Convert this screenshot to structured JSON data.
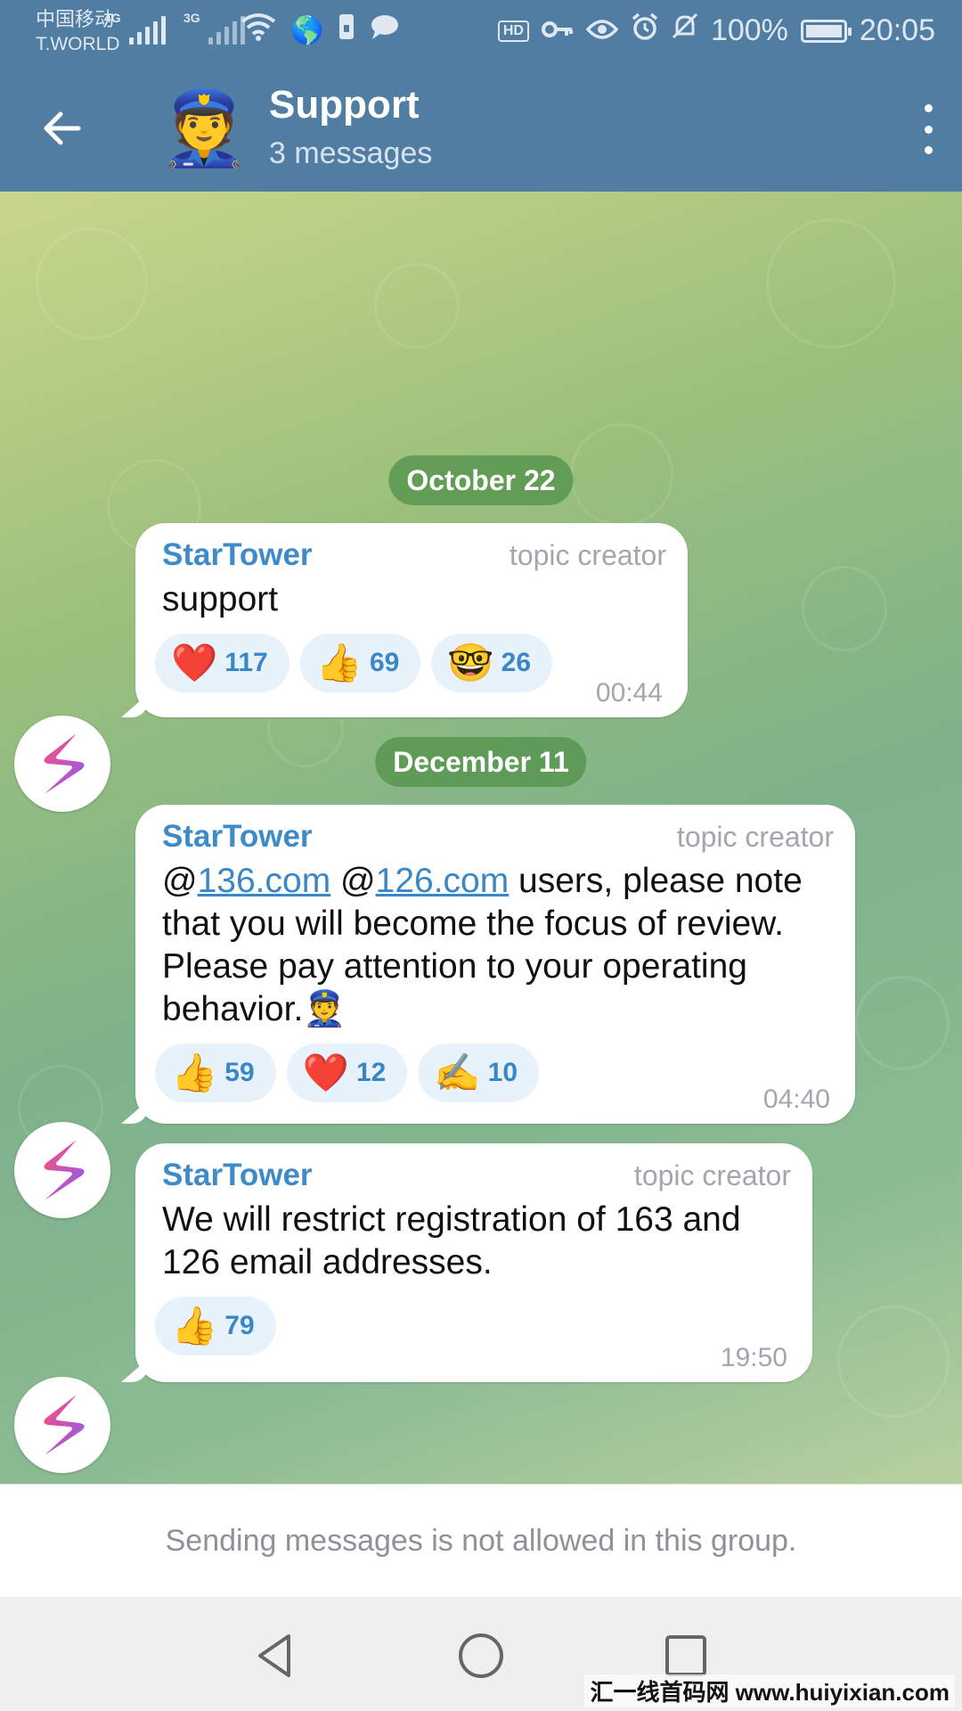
{
  "status_bar": {
    "carrier": "中国移动",
    "carrier_sub": "T.WORLD",
    "net1": "4G",
    "net2": "3G",
    "hd": "HD",
    "battery": "100%",
    "time": "20:05"
  },
  "header": {
    "title": "Support",
    "subtitle": "3 messages",
    "avatar_emoji": "👮"
  },
  "dates": [
    "October 22",
    "December 11"
  ],
  "messages": [
    {
      "sender": "StarTower",
      "role": "topic creator",
      "text": "support",
      "time": "00:44",
      "reactions": [
        {
          "emoji": "❤️",
          "count": "117"
        },
        {
          "emoji": "👍",
          "count": "69"
        },
        {
          "emoji": "🤓",
          "count": "26"
        }
      ]
    },
    {
      "sender": "StarTower",
      "role": "topic creator",
      "text_parts": {
        "at1": "@",
        "link1": "136.com",
        "sp": " ",
        "at2": "@",
        "link2": "126.com",
        "rest": " users, please note that you will become the focus of review. Please pay attention to your operating behavior.",
        "emoji": "👮"
      },
      "time": "04:40",
      "reactions": [
        {
          "emoji": "👍",
          "count": "59"
        },
        {
          "emoji": "❤️",
          "count": "12"
        },
        {
          "emoji": "✍️",
          "count": "10"
        }
      ]
    },
    {
      "sender": "StarTower",
      "role": "topic creator",
      "text": "We will restrict registration of 163 and 126 email addresses.",
      "time": "19:50",
      "reactions": [
        {
          "emoji": "👍",
          "count": "79"
        }
      ]
    }
  ],
  "footer": {
    "notice": "Sending messages is not allowed in this group."
  },
  "watermark": "汇一线首码网 www.huiyixian.com",
  "colors": {
    "header": "#517da2",
    "sender": "#3d8bc9",
    "date_pill": "#5a9650",
    "reaction_bg": "#e8f2fb"
  }
}
